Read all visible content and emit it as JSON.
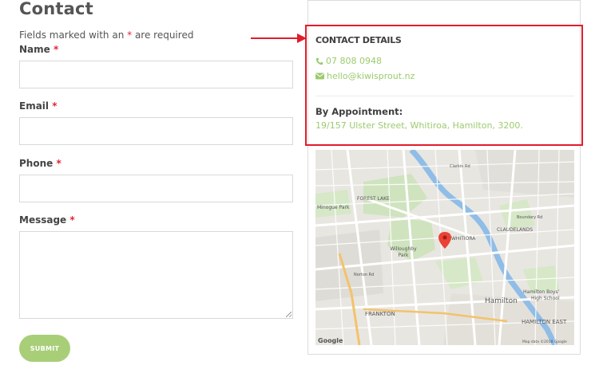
{
  "page": {
    "title": "Contact"
  },
  "form": {
    "required_note_prefix": "Fields marked with an ",
    "required_star": "*",
    "required_note_suffix": " are required",
    "fields": {
      "name": {
        "label": "Name",
        "value": ""
      },
      "email": {
        "label": "Email",
        "value": ""
      },
      "phone": {
        "label": "Phone",
        "value": ""
      },
      "message": {
        "label": "Message",
        "value": ""
      }
    },
    "submit_label": "SUBMIT"
  },
  "details": {
    "title": "CONTACT DETAILS",
    "phone": "07 808 0948",
    "email": "hello@kiwisprout.nz",
    "appointment_title": "By Appointment:",
    "address": "19/157 Ulster Street, Whitiroa, Hamilton, 3200."
  },
  "map": {
    "labels": {
      "forest_lake": "FOREST LAKE",
      "minogue_park": "Minogue Park",
      "willoughby_park": "Willoughby\nPark",
      "whitiora": "WHITIORA",
      "claudelands": "CLAUDELANDS",
      "hamilton": "Hamilton",
      "frankton": "FRANKTON",
      "hamilton_boys": "Hamilton Boys'\nHigh School",
      "hamilton_east": "HAMILTON EAST",
      "clarkin_rd": "Clarkin Rd",
      "boundary_rd": "Boundary Rd",
      "norton_rd": "Norton Rd",
      "google": "Google",
      "map_data": "Map data ©2018 Google"
    }
  },
  "colors": {
    "accent_green": "#9ccb6e",
    "button_green": "#a8cf78",
    "highlight_red": "#e21c2b",
    "required_red": "#e0263a",
    "river_blue": "#8fbde7"
  },
  "icons": {
    "phone": "phone-icon",
    "email": "envelope-icon",
    "marker": "map-marker-icon"
  }
}
